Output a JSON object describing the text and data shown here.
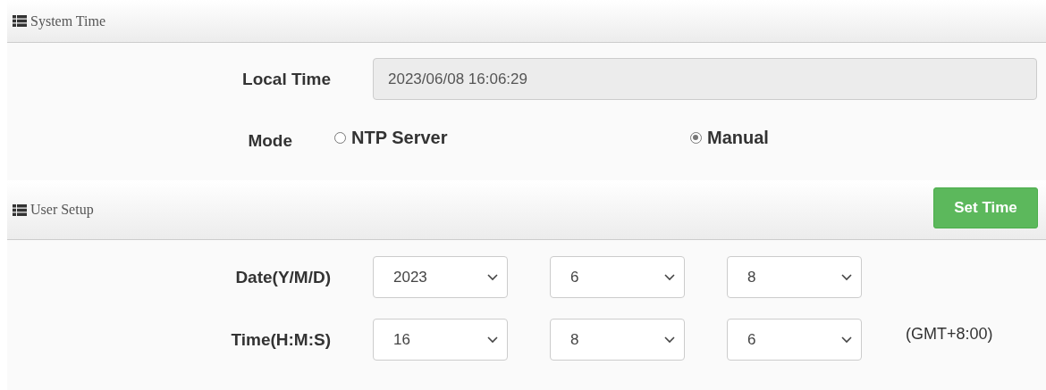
{
  "system_time": {
    "title": "System Time",
    "local_time": {
      "label": "Local Time",
      "value": "2023/06/08 16:06:29"
    },
    "mode": {
      "label": "Mode",
      "options": [
        {
          "label": "NTP Server",
          "selected": false
        },
        {
          "label": "Manual",
          "selected": true
        }
      ]
    }
  },
  "user_setup": {
    "title": "User Setup",
    "button": "Set Time",
    "date": {
      "label": "Date(Y/M/D)",
      "values": [
        "2023",
        "6",
        "8"
      ]
    },
    "time": {
      "label": "Time(H:M:S)",
      "values": [
        "16",
        "8",
        "6"
      ]
    },
    "timezone": "(GMT+8:00)"
  }
}
